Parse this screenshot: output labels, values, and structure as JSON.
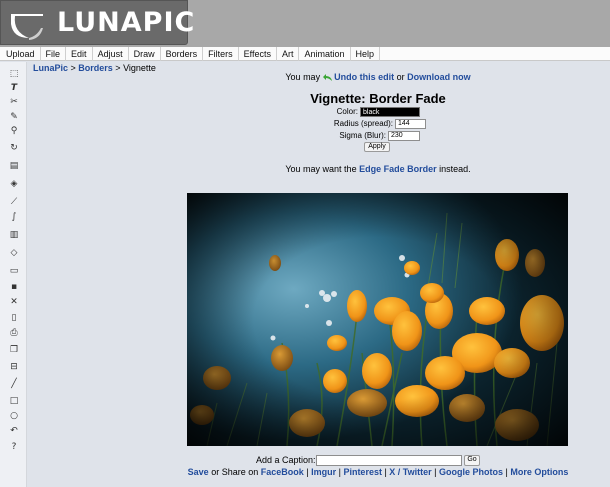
{
  "header": {
    "logo_text": "LUNAPIC"
  },
  "menu": [
    "Upload",
    "File",
    "Edit",
    "Adjust",
    "Draw",
    "Borders",
    "Filters",
    "Effects",
    "Art",
    "Animation",
    "Help"
  ],
  "toolbar_icons": [
    "select-icon",
    "text-icon",
    "cut-icon",
    "pencil-icon",
    "zoom-icon",
    "rotate-icon",
    "crop-icon",
    "fill-icon",
    "eyedropper-icon",
    "brush-icon",
    "layers-icon",
    "eraser-icon",
    "open-icon",
    "save-icon",
    "close-icon",
    "new-icon",
    "print-icon",
    "copy-icon",
    "paste-icon",
    "line-icon",
    "rectangle-icon",
    "circle-icon",
    "undo-icon",
    "help-icon"
  ],
  "breadcrumb": {
    "root": "LunaPic",
    "sep1": " > ",
    "section": "Borders",
    "sep2": " > ",
    "current": "Vignette"
  },
  "undo_line": {
    "prefix": "You may ",
    "undo_link": "Undo this edit",
    "middle": " or ",
    "download_link": "Download now"
  },
  "panel": {
    "title": "Vignette: Border Fade",
    "color_label": "Color:",
    "color_value": "black",
    "radius_label": "Radius (spread):",
    "radius_value": "144",
    "sigma_label": "Sigma (Blur):",
    "sigma_value": "230",
    "apply_label": "Apply"
  },
  "edge_line": {
    "prefix": "You may want the ",
    "link": "Edge Fade Border",
    "suffix": " instead."
  },
  "caption": {
    "label": "Add a Caption:",
    "value": "",
    "go_label": "Go"
  },
  "share": {
    "save": "Save",
    "middle": " or Share on ",
    "facebook": "FaceBook",
    "sep1": " | ",
    "imgur": "Imgur",
    "sep2": " | ",
    "pinterest": "Pinterest",
    "sep3": " | ",
    "twitter": "X / Twitter",
    "sep4": " | ",
    "google_photos": "Google Photos",
    "sep5": " | ",
    "more_options": "More Options"
  },
  "colors": {
    "link": "#234d9c",
    "background": "#dfe3ea",
    "header": "#a8a8a8",
    "logo_box": "#6a6a6a",
    "undo_icon": "#3aa535"
  }
}
